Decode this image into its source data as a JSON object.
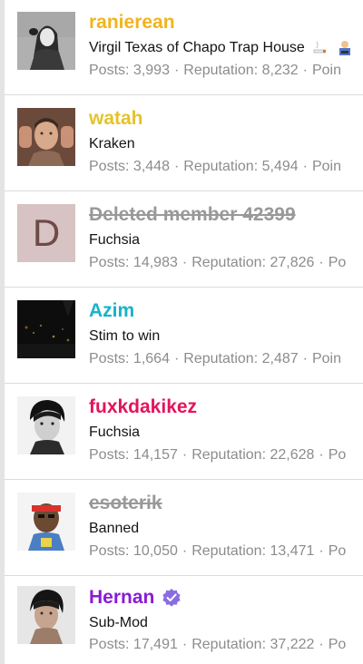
{
  "labels": {
    "posts": "Posts:",
    "reputation": "Reputation:",
    "points": "Poin",
    "separator": "·"
  },
  "members": [
    {
      "name": "ranierean",
      "name_color": "#f1b41c",
      "title": "Virgil Texas of Chapo Trap House",
      "posts": "3,993",
      "reputation": "8,232",
      "extra": "Poin"
    },
    {
      "name": "watah",
      "name_color": "#e4c32b",
      "title": "Kraken",
      "posts": "3,448",
      "reputation": "5,494",
      "extra": "Poin"
    },
    {
      "name": "Deleted member 42399",
      "name_color": "#999999",
      "avatar_letter": "D",
      "title": "Fuchsia",
      "posts": "14,983",
      "reputation": "27,826",
      "extra": "Po"
    },
    {
      "name": "Azim",
      "name_color": "#16b3c9",
      "title": "Stim to win",
      "posts": "1,664",
      "reputation": "2,487",
      "extra": "Poin"
    },
    {
      "name": "fuxkdakikez",
      "name_color": "#e5135c",
      "title": "Fuchsia",
      "posts": "14,157",
      "reputation": "22,628",
      "extra": "Po"
    },
    {
      "name": "esoterik",
      "name_color": "#999999",
      "title": "Banned",
      "posts": "10,050",
      "reputation": "13,471",
      "extra": "Po"
    },
    {
      "name": "Hernan",
      "name_color": "#8a1bd6",
      "title": "Sub-Mod",
      "posts": "17,491",
      "reputation": "37,222",
      "extra": "Po"
    }
  ],
  "icons": {
    "verified": "verified-check-icon",
    "title_emoji_1": "cigarette-icon",
    "title_emoji_2": "gamer-icon"
  }
}
